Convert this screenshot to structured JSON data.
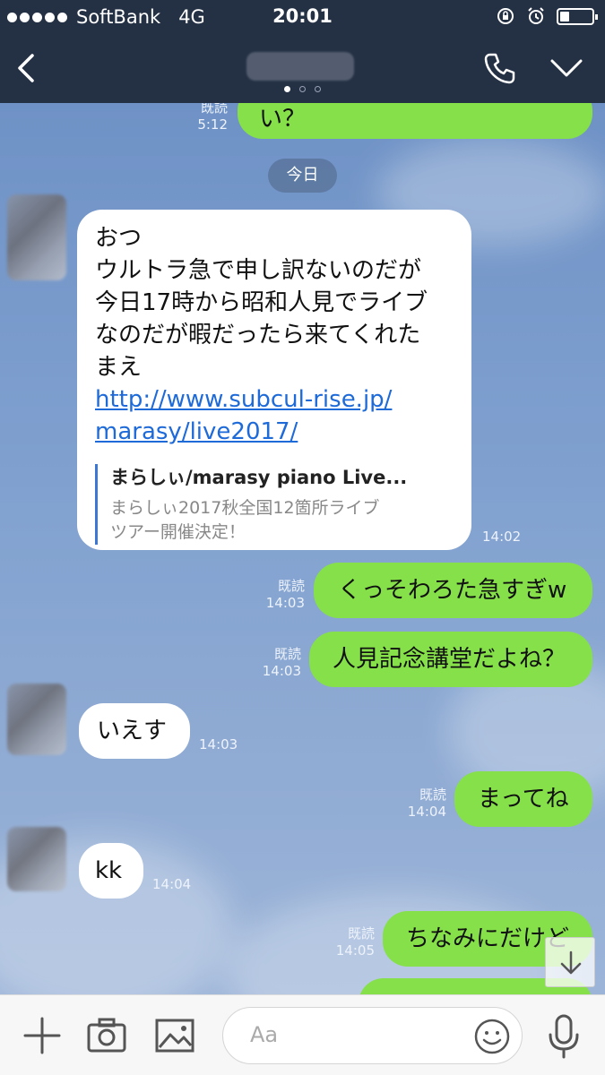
{
  "status_bar": {
    "carrier": "SoftBank",
    "network": "4G",
    "time": "20:01",
    "battery_level": 0.3
  },
  "nav": {
    "contact_name": ""
  },
  "chat": {
    "date_divider": "今日",
    "top_partial": {
      "text": "い？",
      "read": "既読",
      "time": "5:12"
    },
    "messages": [
      {
        "side": "in",
        "lines": [
          "おつ",
          "ウルトラ急で申し訳ないのだが",
          "今日17時から昭和人見でライブ",
          "なのだが暇だったら来てくれた",
          "まえ"
        ],
        "link": [
          "http://www.subcul-rise.jp/",
          "marasy/live2017/"
        ],
        "preview_title": "まらしぃ/marasy piano Live...",
        "preview_desc": [
          "まらしぃ2017秋全国12箇所ライブ",
          "ツアー開催決定！"
        ],
        "time": "14:02"
      },
      {
        "side": "out",
        "text": "くっそわろた急すぎw",
        "read": "既読",
        "time": "14:03"
      },
      {
        "side": "out",
        "text": "人見記念講堂だよね？",
        "read": "既読",
        "time": "14:03"
      },
      {
        "side": "in",
        "text": "いえす",
        "time": "14:03"
      },
      {
        "side": "out",
        "text": "まってね",
        "read": "既読",
        "time": "14:04"
      },
      {
        "side": "in",
        "text": "kk",
        "time": "14:04"
      },
      {
        "side": "out",
        "text": "ちなみにだけど",
        "read": "既読",
        "time": "14:05"
      }
    ]
  },
  "input": {
    "placeholder": "Aa"
  },
  "icons": [
    "back-icon",
    "phone-icon",
    "chevron-down-icon",
    "plus-icon",
    "camera-icon",
    "image-icon",
    "emoji-icon",
    "mic-icon",
    "arrow-down-icon",
    "alarm-icon",
    "lock-rotation-icon"
  ]
}
